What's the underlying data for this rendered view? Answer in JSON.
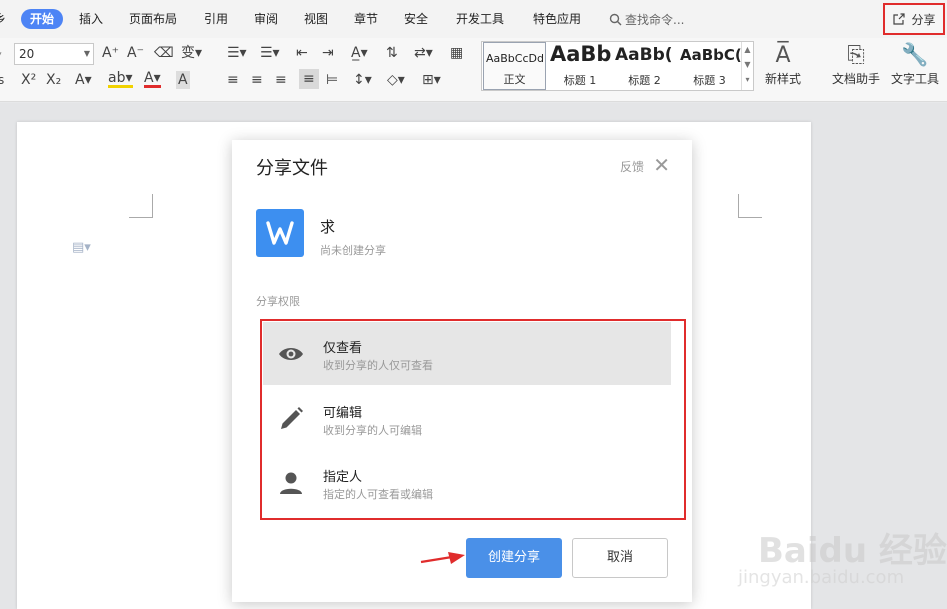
{
  "menu": {
    "tabs": [
      {
        "label": "乡"
      },
      {
        "label": "开始"
      },
      {
        "label": "插入"
      },
      {
        "label": "页面布局"
      },
      {
        "label": "引用"
      },
      {
        "label": "审阅"
      },
      {
        "label": "视图"
      },
      {
        "label": "章节"
      },
      {
        "label": "安全"
      },
      {
        "label": "开发工具"
      },
      {
        "label": "特色应用"
      }
    ],
    "active_tab": "开始",
    "search_label": "查找命令...",
    "share_label": "分享"
  },
  "ribbon": {
    "font_size_value": "20",
    "styles": [
      {
        "sample": "AaBbCcDd",
        "caption": "正文"
      },
      {
        "sample": "AaBb",
        "caption": "标题 1"
      },
      {
        "sample": "AaBb(",
        "caption": "标题 2"
      },
      {
        "sample": "AaBbC(",
        "caption": "标题 3"
      }
    ],
    "new_style_label": "新样式",
    "doc_assistant_label": "文档助手",
    "text_tools_label": "文字工具"
  },
  "dialog": {
    "title": "分享文件",
    "feedback_label": "反馈",
    "file": {
      "icon_letter": "W",
      "name": "求",
      "status": "尚未创建分享"
    },
    "permission_label": "分享权限",
    "options": [
      {
        "title": "仅查看",
        "desc": "收到分享的人仅可查看",
        "icon": "eye-icon",
        "selected": true
      },
      {
        "title": "可编辑",
        "desc": "收到分享的人可编辑",
        "icon": "pencil-icon",
        "selected": false
      },
      {
        "title": "指定人",
        "desc": "指定的人可查看或编辑",
        "icon": "person-icon",
        "selected": false
      }
    ],
    "create_label": "创建分享",
    "cancel_label": "取消"
  },
  "watermark": {
    "main": "Baidu 经验",
    "sub": "jingyan.baidu.com"
  },
  "colors": {
    "accent": "#4d84f5",
    "primary_button": "#4a90e8",
    "highlight_border": "#e02c2c",
    "file_icon": "#3d8ff0",
    "selected_option_bg": "#e6e6e6"
  }
}
